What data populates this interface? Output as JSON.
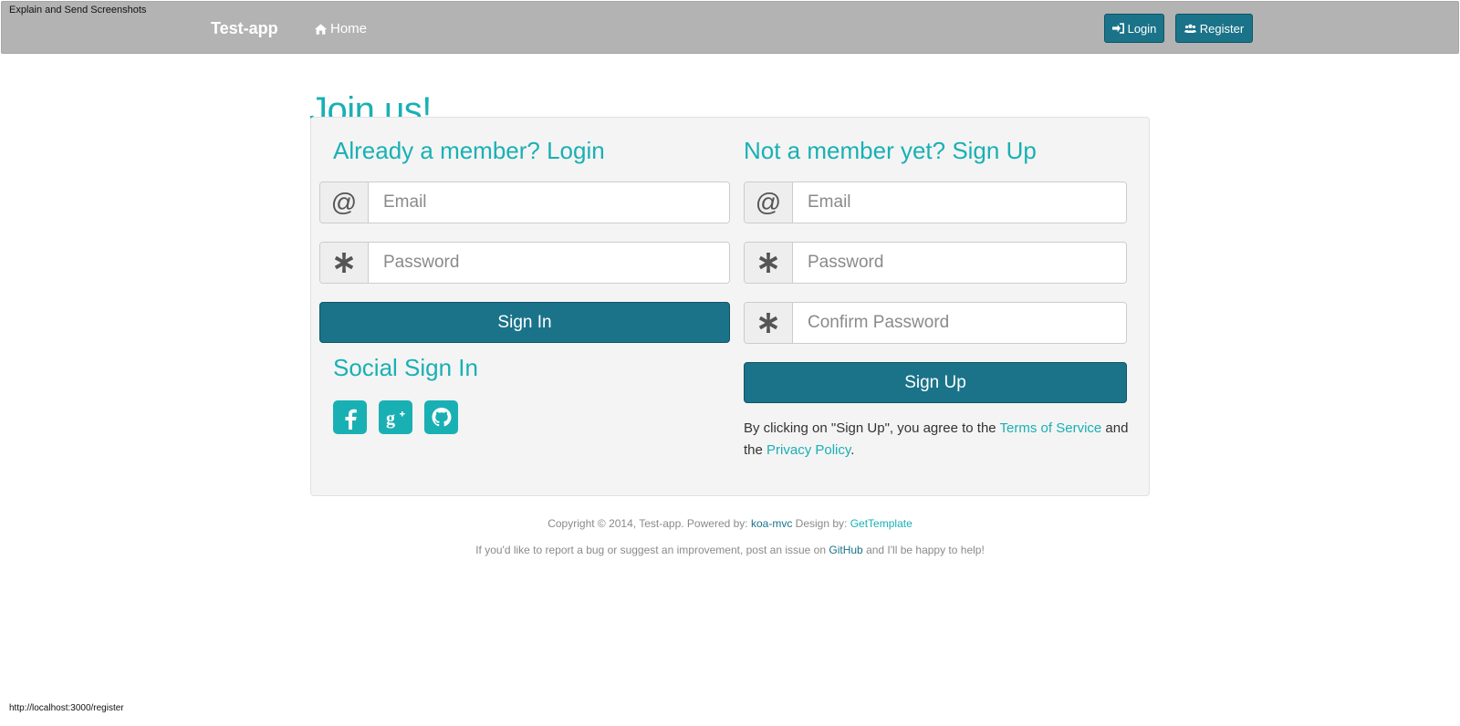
{
  "extension_note": "Explain and Send Screenshots",
  "navbar": {
    "brand": "Test-app",
    "home_label": "Home",
    "login_label": "Login",
    "register_label": "Register"
  },
  "page": {
    "title": "Join us!"
  },
  "login_form": {
    "heading": "Already a member? Login",
    "email_placeholder": "Email",
    "password_placeholder": "Password",
    "submit_label": "Sign In",
    "social_heading": "Social Sign In",
    "social_icons": [
      "facebook-icon",
      "google-plus-icon",
      "github-icon"
    ]
  },
  "signup_form": {
    "heading": "Not a member yet? Sign Up",
    "email_placeholder": "Email",
    "password_placeholder": "Password",
    "confirm_placeholder": "Confirm Password",
    "submit_label": "Sign Up",
    "terms_prefix": "By clicking on \"Sign Up\", you agree to the",
    "terms_link": "Terms of Service",
    "terms_mid": "and the",
    "privacy_link": "Privacy Policy",
    "terms_suffix": "."
  },
  "footer": {
    "copyright_prefix": "Copyright © 2014, Test-app. Powered by:",
    "powered_link": "koa-mvc",
    "design_prefix": "Design by:",
    "design_link": "GetTemplate",
    "report_prefix": "If you'd like to report a bug or suggest an improvement, post an issue on",
    "report_link": "GitHub",
    "report_suffix": "and I'll be happy to help!"
  },
  "status_bar": {
    "url": "http://localhost:3000/register"
  },
  "colors": {
    "accent": "#19b0b4",
    "button": "#1a7389",
    "navbar": "#b3b3b3",
    "panel": "#f4f4f4"
  }
}
